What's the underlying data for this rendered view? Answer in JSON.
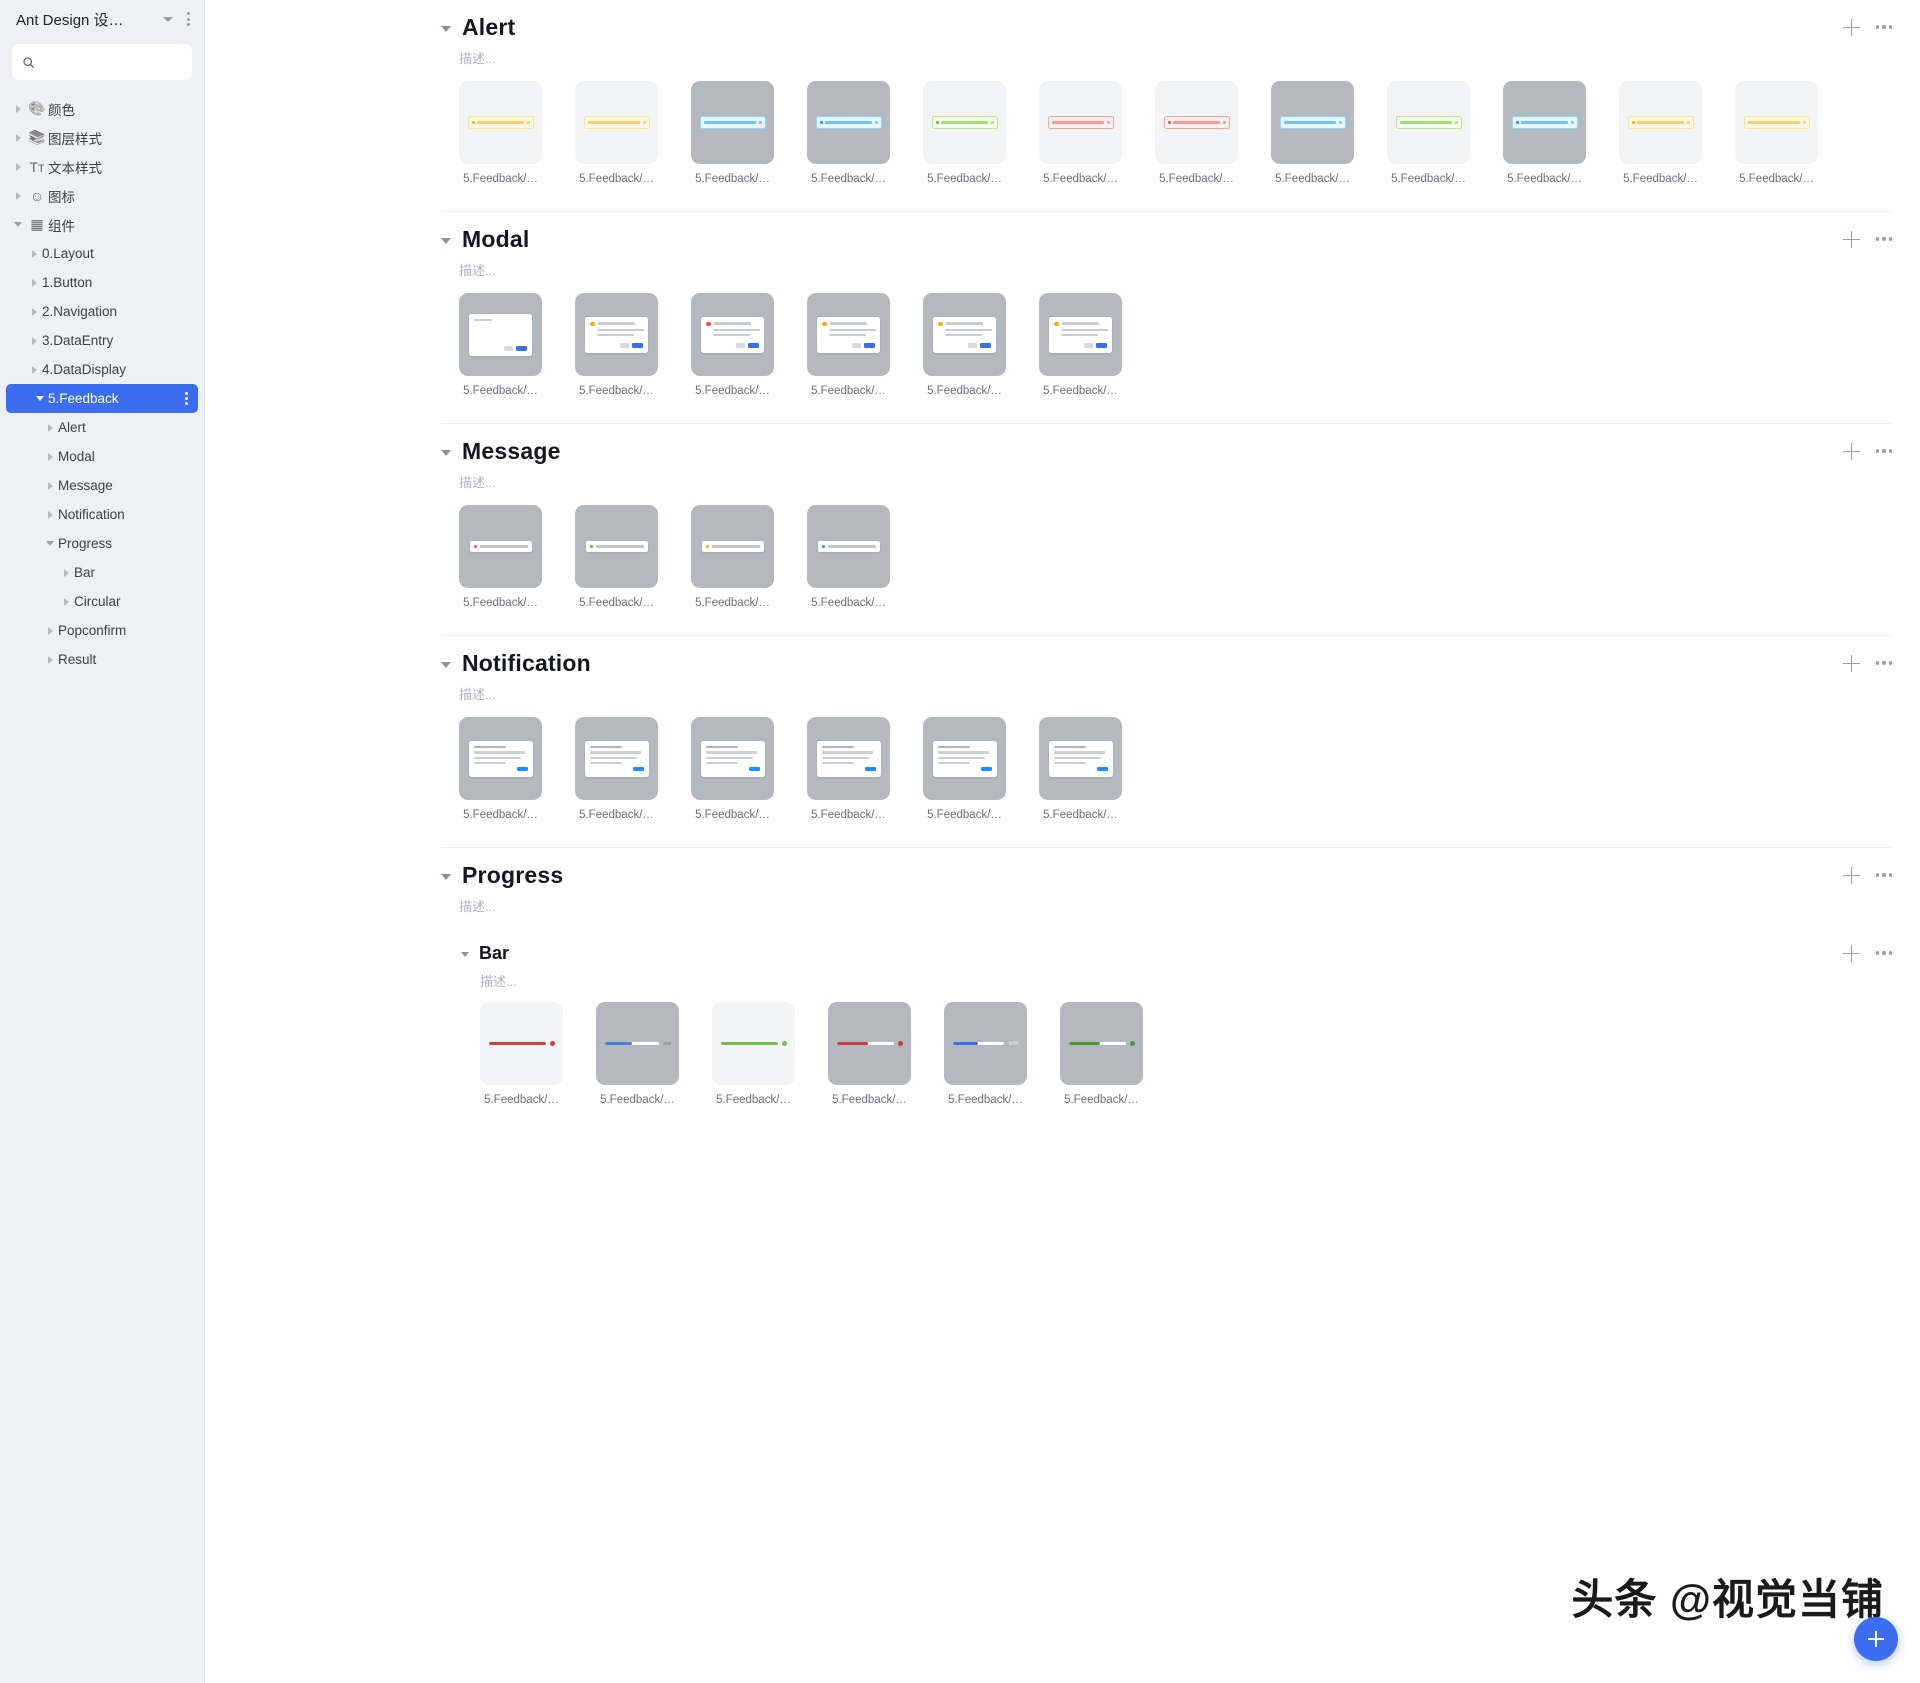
{
  "sidebar": {
    "title": "Ant Design 设…",
    "search_placeholder": "",
    "search_value": "",
    "tree": [
      {
        "label": "颜色",
        "level": 0,
        "icon": "palette-icon",
        "glyph": "🎨",
        "arrow": "right",
        "selected": false
      },
      {
        "label": "图层样式",
        "level": 0,
        "icon": "layers-icon",
        "glyph": "📚",
        "arrow": "right",
        "selected": false
      },
      {
        "label": "文本样式",
        "level": 0,
        "icon": "text-style-icon",
        "glyph": "Tт",
        "arrow": "right",
        "selected": false
      },
      {
        "label": "图标",
        "level": 0,
        "icon": "smiley-icon",
        "glyph": "☺",
        "arrow": "right",
        "selected": false
      },
      {
        "label": "组件",
        "level": 0,
        "icon": "components-icon",
        "glyph": "▦",
        "arrow": "down",
        "selected": false
      },
      {
        "label": "0.Layout",
        "level": 1,
        "icon": "",
        "glyph": "",
        "arrow": "right",
        "selected": false
      },
      {
        "label": "1.Button",
        "level": 1,
        "icon": "",
        "glyph": "",
        "arrow": "right",
        "selected": false
      },
      {
        "label": "2.Navigation",
        "level": 1,
        "icon": "",
        "glyph": "",
        "arrow": "right",
        "selected": false
      },
      {
        "label": "3.DataEntry",
        "level": 1,
        "icon": "",
        "glyph": "",
        "arrow": "right",
        "selected": false
      },
      {
        "label": "4.DataDisplay",
        "level": 1,
        "icon": "",
        "glyph": "",
        "arrow": "right",
        "selected": false
      },
      {
        "label": "5.Feedback",
        "level": 1,
        "icon": "",
        "glyph": "",
        "arrow": "down",
        "selected": true
      },
      {
        "label": "Alert",
        "level": 2,
        "icon": "",
        "glyph": "",
        "arrow": "right",
        "selected": false
      },
      {
        "label": "Modal",
        "level": 2,
        "icon": "",
        "glyph": "",
        "arrow": "right",
        "selected": false
      },
      {
        "label": "Message",
        "level": 2,
        "icon": "",
        "glyph": "",
        "arrow": "right",
        "selected": false
      },
      {
        "label": "Notification",
        "level": 2,
        "icon": "",
        "glyph": "",
        "arrow": "right",
        "selected": false
      },
      {
        "label": "Progress",
        "level": 2,
        "icon": "",
        "glyph": "",
        "arrow": "down",
        "selected": false
      },
      {
        "label": "Bar",
        "level": 3,
        "icon": "",
        "glyph": "",
        "arrow": "right",
        "selected": false
      },
      {
        "label": "Circular",
        "level": 3,
        "icon": "",
        "glyph": "",
        "arrow": "right",
        "selected": false
      },
      {
        "label": "Popconfirm",
        "level": 2,
        "icon": "",
        "glyph": "",
        "arrow": "right",
        "selected": false
      },
      {
        "label": "Result",
        "level": 2,
        "icon": "",
        "glyph": "",
        "arrow": "right",
        "selected": false
      }
    ]
  },
  "sections": [
    {
      "title": "Alert",
      "description": "描述...",
      "kind": "alert",
      "cards": [
        {
          "label": "5.Feedback/…",
          "bg": "light",
          "variant": "warning",
          "icon": true,
          "accent": "#faad14",
          "fill": "#fff7e6",
          "border": "#ffe58f"
        },
        {
          "label": "5.Feedback/…",
          "bg": "light",
          "variant": "warning",
          "icon": false,
          "accent": "#faad14",
          "fill": "#fff7e6",
          "border": "#ffe58f"
        },
        {
          "label": "5.Feedback/…",
          "bg": "dark",
          "variant": "info",
          "icon": false,
          "accent": "#1890ff",
          "fill": "#e6f7ff",
          "border": "#91d5ff"
        },
        {
          "label": "5.Feedback/…",
          "bg": "dark",
          "variant": "info",
          "icon": true,
          "accent": "#1890ff",
          "fill": "#e6f7ff",
          "border": "#91d5ff"
        },
        {
          "label": "5.Feedback/…",
          "bg": "light",
          "variant": "success",
          "icon": true,
          "accent": "#52c41a",
          "fill": "#f6ffed",
          "border": "#b7eb8f"
        },
        {
          "label": "5.Feedback/…",
          "bg": "light",
          "variant": "error",
          "icon": false,
          "accent": "#ff4d4f",
          "fill": "#fff1f0",
          "border": "#ffa39e"
        },
        {
          "label": "5.Feedback/…",
          "bg": "light",
          "variant": "error",
          "icon": true,
          "accent": "#ff4d4f",
          "fill": "#fff1f0",
          "border": "#ffa39e"
        },
        {
          "label": "5.Feedback/…",
          "bg": "dark",
          "variant": "info",
          "icon": false,
          "accent": "#1890ff",
          "fill": "#e6f7ff",
          "border": "#91d5ff"
        },
        {
          "label": "5.Feedback/…",
          "bg": "light",
          "variant": "success",
          "icon": false,
          "accent": "#52c41a",
          "fill": "#f6ffed",
          "border": "#b7eb8f"
        },
        {
          "label": "5.Feedback/…",
          "bg": "dark",
          "variant": "info",
          "icon": true,
          "accent": "#1890ff",
          "fill": "#e6f7ff",
          "border": "#91d5ff"
        },
        {
          "label": "5.Feedback/…",
          "bg": "light",
          "variant": "warning",
          "icon": true,
          "accent": "#faad14",
          "fill": "#fff7e6",
          "border": "#ffe58f"
        },
        {
          "label": "5.Feedback/…",
          "bg": "light",
          "variant": "warning",
          "icon": false,
          "accent": "#faad14",
          "fill": "#fff7e6",
          "border": "#ffe58f"
        }
      ]
    },
    {
      "title": "Modal",
      "description": "描述...",
      "kind": "modal",
      "cards": [
        {
          "label": "5.Feedback/…",
          "bg": "dark",
          "accent": "#d9d9d9",
          "icon": false,
          "big": true
        },
        {
          "label": "5.Feedback/…",
          "bg": "dark",
          "accent": "#faad14",
          "icon": true,
          "big": false
        },
        {
          "label": "5.Feedback/…",
          "bg": "dark",
          "accent": "#ff4d4f",
          "icon": true,
          "big": false
        },
        {
          "label": "5.Feedback/…",
          "bg": "dark",
          "accent": "#faad14",
          "icon": true,
          "big": false
        },
        {
          "label": "5.Feedback/…",
          "bg": "dark",
          "accent": "#faad14",
          "icon": true,
          "big": false
        },
        {
          "label": "5.Feedback/…",
          "bg": "dark",
          "accent": "#faad14",
          "icon": true,
          "big": false
        }
      ]
    },
    {
      "title": "Message",
      "description": "描述...",
      "kind": "message",
      "cards": [
        {
          "label": "5.Feedback/…",
          "bg": "dark",
          "accent": "#ff4d4f"
        },
        {
          "label": "5.Feedback/…",
          "bg": "dark",
          "accent": "#52c41a"
        },
        {
          "label": "5.Feedback/…",
          "bg": "dark",
          "accent": "#faad14"
        },
        {
          "label": "5.Feedback/…",
          "bg": "dark",
          "accent": "#1890ff"
        }
      ]
    },
    {
      "title": "Notification",
      "description": "描述...",
      "kind": "notification",
      "cards": [
        {
          "label": "5.Feedback/…",
          "bg": "dark",
          "accent": "#1890ff"
        },
        {
          "label": "5.Feedback/…",
          "bg": "dark",
          "accent": "#1890ff"
        },
        {
          "label": "5.Feedback/…",
          "bg": "dark",
          "accent": "#1890ff"
        },
        {
          "label": "5.Feedback/…",
          "bg": "dark",
          "accent": "#1890ff"
        },
        {
          "label": "5.Feedback/…",
          "bg": "dark",
          "accent": "#1890ff"
        },
        {
          "label": "5.Feedback/…",
          "bg": "dark",
          "accent": "#1890ff"
        }
      ]
    },
    {
      "title": "Progress",
      "description": "描述...",
      "kind": "progress-group",
      "cards": [],
      "subsection": {
        "title": "Bar",
        "description": "描述...",
        "cards": [
          {
            "label": "5.Feedback/…",
            "bg": "light",
            "color": "#cf4040",
            "percent": 100,
            "end": "dot",
            "pct_text": ""
          },
          {
            "label": "5.Feedback/…",
            "bg": "dark",
            "color": "#4a7fd4",
            "percent": 50,
            "end": "text",
            "pct_text": ""
          },
          {
            "label": "5.Feedback/…",
            "bg": "light",
            "color": "#6fbf4a",
            "percent": 100,
            "end": "dot",
            "pct_text": ""
          },
          {
            "label": "5.Feedback/…",
            "bg": "dark",
            "color": "#cf3b3b",
            "percent": 55,
            "end": "close",
            "pct_text": ""
          },
          {
            "label": "5.Feedback/…",
            "bg": "dark",
            "color": "#3c6df0",
            "percent": 50,
            "end": "pct",
            "pct_text": "50%"
          },
          {
            "label": "5.Feedback/…",
            "bg": "dark",
            "color": "#4a9b2f",
            "percent": 55,
            "end": "check",
            "pct_text": ""
          }
        ]
      }
    }
  ],
  "watermark": "头条 @视觉当铺",
  "fab": {
    "icon": "plus-icon"
  },
  "icons": {
    "add": "plus-icon",
    "more": "more-horizontal-icon",
    "search": "search-icon"
  },
  "colors": {
    "accent": "#3c6df0",
    "sidebar_bg": "#eef0f4",
    "canvas_bg": "#ffffff"
  }
}
